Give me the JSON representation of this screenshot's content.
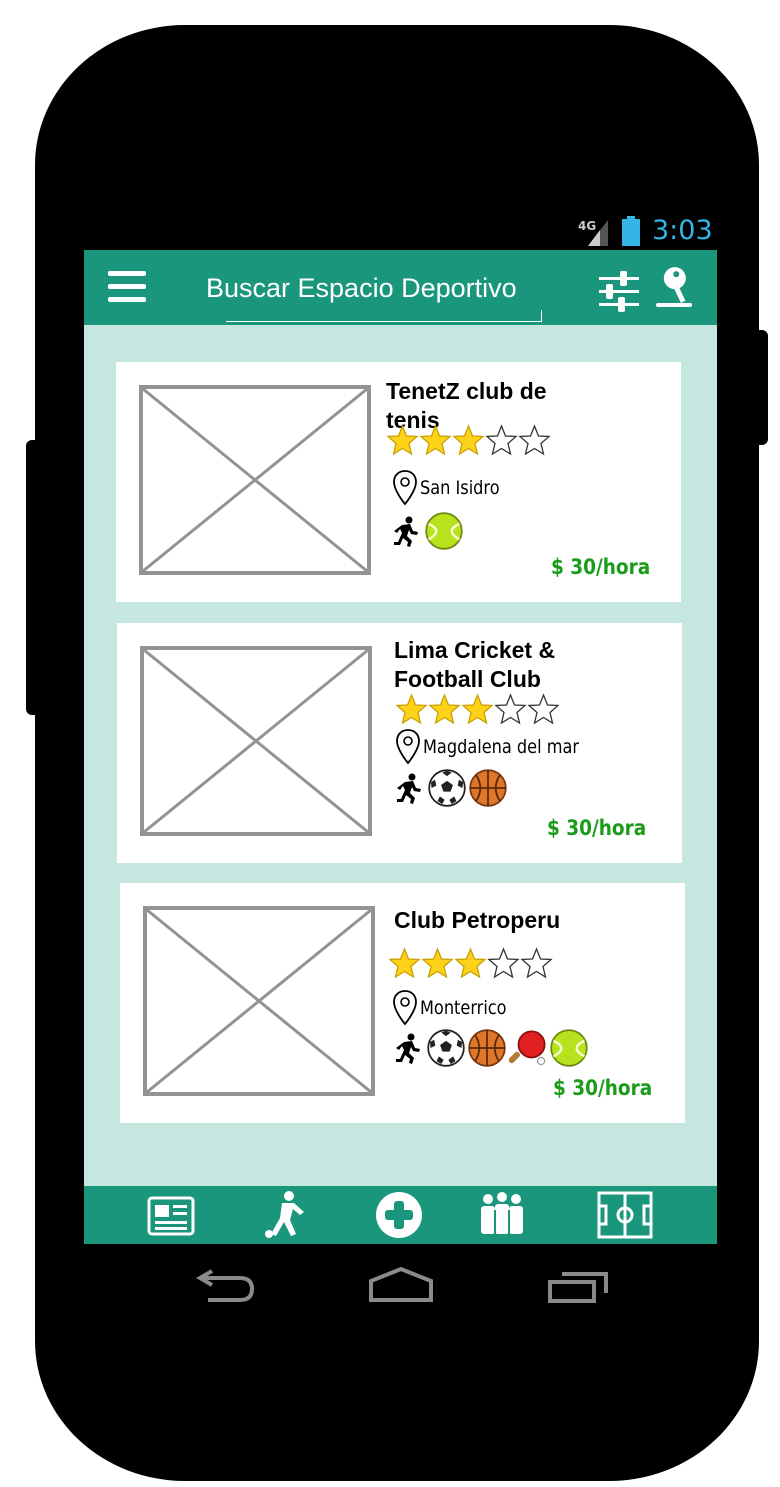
{
  "status": {
    "network": "4G",
    "time": "3:03"
  },
  "appbar": {
    "title": "Buscar Espacio Deportivo"
  },
  "colors": {
    "primary": "#1a967c",
    "background": "#c5e7e0",
    "price": "#1a9c1a",
    "status_time": "#33b5e5"
  },
  "venues": [
    {
      "name": "TenetZ club de tenis",
      "rating": 3,
      "max_rating": 5,
      "location": "San Isidro",
      "sports": [
        "running-icon",
        "tennis-ball-icon"
      ],
      "price": "$ 30/hora"
    },
    {
      "name": "Lima Cricket & Football Club",
      "rating": 3,
      "max_rating": 5,
      "location": "Magdalena del mar",
      "sports": [
        "running-icon",
        "soccer-ball-icon",
        "basketball-icon"
      ],
      "price": "$ 30/hora"
    },
    {
      "name": "Club Petroperu",
      "rating": 3,
      "max_rating": 5,
      "location": "Monterrico",
      "sports": [
        "running-icon",
        "soccer-ball-icon",
        "basketball-icon",
        "ping-pong-icon",
        "tennis-ball-icon"
      ],
      "price": "$ 30/hora"
    }
  ],
  "bottom_nav": [
    "news-icon",
    "player-icon",
    "add-icon",
    "team-icon",
    "field-icon"
  ],
  "system_nav": [
    "back-icon",
    "home-icon",
    "recents-icon"
  ]
}
